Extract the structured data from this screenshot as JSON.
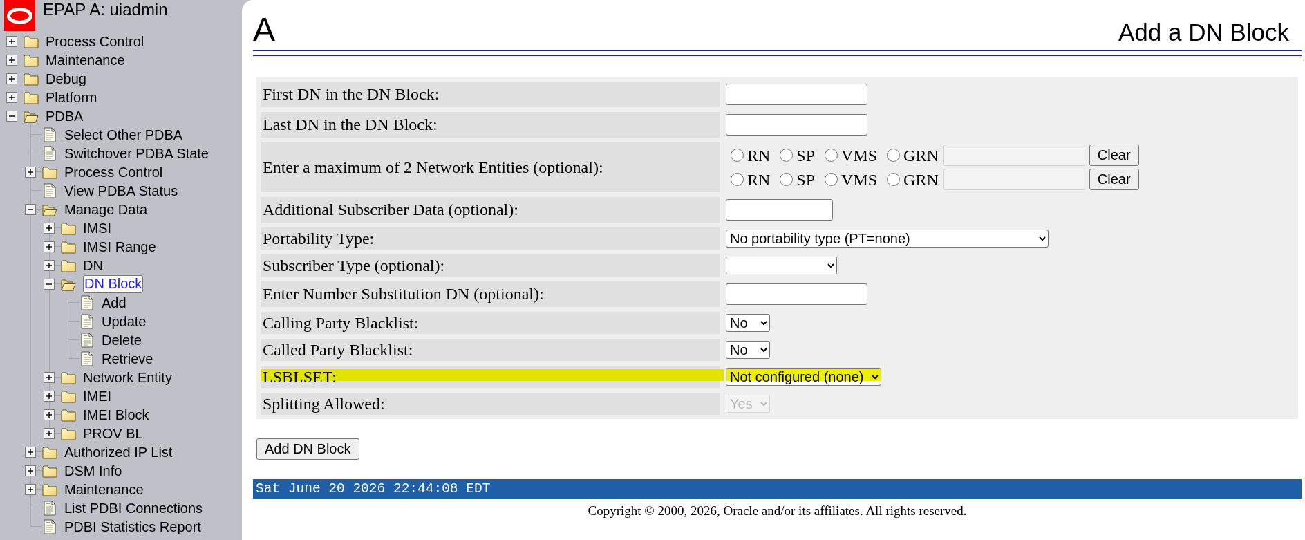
{
  "sidebar": {
    "title": "EPAP A: uiadmin",
    "items": [
      {
        "label": "Process Control",
        "kind": "folder",
        "expanded": false,
        "selected": false
      },
      {
        "label": "Maintenance",
        "kind": "folder",
        "expanded": false,
        "selected": false
      },
      {
        "label": "Debug",
        "kind": "folder",
        "expanded": false,
        "selected": false
      },
      {
        "label": "Platform",
        "kind": "folder",
        "expanded": false,
        "selected": false
      },
      {
        "label": "PDBA",
        "kind": "folder",
        "expanded": true,
        "selected": false,
        "children": [
          {
            "label": "Select Other PDBA",
            "kind": "page",
            "selected": false
          },
          {
            "label": "Switchover PDBA State",
            "kind": "page",
            "selected": false
          },
          {
            "label": "Process Control",
            "kind": "folder",
            "expanded": false,
            "selected": false
          },
          {
            "label": "View PDBA Status",
            "kind": "page",
            "selected": false
          },
          {
            "label": "Manage Data",
            "kind": "folder",
            "expanded": true,
            "selected": false,
            "children": [
              {
                "label": "IMSI",
                "kind": "folder",
                "expanded": false,
                "selected": false
              },
              {
                "label": "IMSI Range",
                "kind": "folder",
                "expanded": false,
                "selected": false
              },
              {
                "label": "DN",
                "kind": "folder",
                "expanded": false,
                "selected": false
              },
              {
                "label": "DN Block",
                "kind": "folder",
                "expanded": true,
                "selected": true,
                "children": [
                  {
                    "label": "Add",
                    "kind": "page",
                    "selected": false
                  },
                  {
                    "label": "Update",
                    "kind": "page",
                    "selected": false
                  },
                  {
                    "label": "Delete",
                    "kind": "page",
                    "selected": false
                  },
                  {
                    "label": "Retrieve",
                    "kind": "page",
                    "selected": false
                  }
                ]
              },
              {
                "label": "Network Entity",
                "kind": "folder",
                "expanded": false,
                "selected": false
              },
              {
                "label": "IMEI",
                "kind": "folder",
                "expanded": false,
                "selected": false
              },
              {
                "label": "IMEI Block",
                "kind": "folder",
                "expanded": false,
                "selected": false
              },
              {
                "label": "PROV BL",
                "kind": "folder",
                "expanded": false,
                "selected": false
              }
            ]
          },
          {
            "label": "Authorized IP List",
            "kind": "folder",
            "expanded": false,
            "selected": false
          },
          {
            "label": "DSM Info",
            "kind": "folder",
            "expanded": false,
            "selected": false
          },
          {
            "label": "Maintenance",
            "kind": "folder",
            "expanded": false,
            "selected": false
          },
          {
            "label": "List PDBI Connections",
            "kind": "page",
            "selected": false
          },
          {
            "label": "PDBI Statistics Report",
            "kind": "page",
            "selected": false
          }
        ]
      }
    ]
  },
  "header": {
    "section_letter": "A",
    "title": "Add a DN Block"
  },
  "form": {
    "rows": [
      {
        "label": "First DN in the DN Block:",
        "kind": "text",
        "disabled": false,
        "highlighted": false
      },
      {
        "label": "Last DN in the DN Block:",
        "kind": "text",
        "disabled": false,
        "highlighted": false
      },
      {
        "label": "Enter a maximum of 2 Network Entities (optional):",
        "kind": "network_entities",
        "disabled": false,
        "highlighted": false,
        "entries": [
          {
            "options": [
              {
                "label": "RN",
                "selected": false
              },
              {
                "label": "SP",
                "selected": false
              },
              {
                "label": "VMS",
                "selected": false
              },
              {
                "label": "GRN",
                "selected": false
              }
            ],
            "field_disabled": true,
            "button": "Clear"
          },
          {
            "options": [
              {
                "label": "RN",
                "selected": false
              },
              {
                "label": "SP",
                "selected": false
              },
              {
                "label": "VMS",
                "selected": false
              },
              {
                "label": "GRN",
                "selected": false
              }
            ],
            "field_disabled": true,
            "button": "Clear"
          }
        ]
      },
      {
        "label": "Additional Subscriber Data (optional):",
        "kind": "text",
        "disabled": false,
        "highlighted": false
      },
      {
        "label": "Portability Type:",
        "kind": "select",
        "value": "No portability type (PT=none)",
        "disabled": false,
        "highlighted": false
      },
      {
        "label": "Subscriber Type (optional):",
        "kind": "select",
        "disabled": false,
        "highlighted": false
      },
      {
        "label": "Enter Number Substitution DN (optional):",
        "kind": "text",
        "disabled": false,
        "highlighted": false
      },
      {
        "label": "Calling Party Blacklist:",
        "kind": "select",
        "value": "No",
        "disabled": false,
        "highlighted": false
      },
      {
        "label": "Called Party Blacklist:",
        "kind": "select",
        "value": "No",
        "disabled": false,
        "highlighted": false
      },
      {
        "label": "LSBLSET:",
        "kind": "select",
        "value": "Not configured (none)",
        "disabled": false,
        "highlighted": true
      },
      {
        "label": "Splitting Allowed:",
        "kind": "select",
        "value": "Yes",
        "disabled": true,
        "highlighted": false
      }
    ]
  },
  "submit_button": "Add DN Block",
  "status_bar": {
    "datetime": "Sat June 20 2026 22:44:08 EDT"
  },
  "footer": {
    "copyright": "Copyright © 2000, 2026, Oracle and/or its affiliates. All rights reserved."
  }
}
